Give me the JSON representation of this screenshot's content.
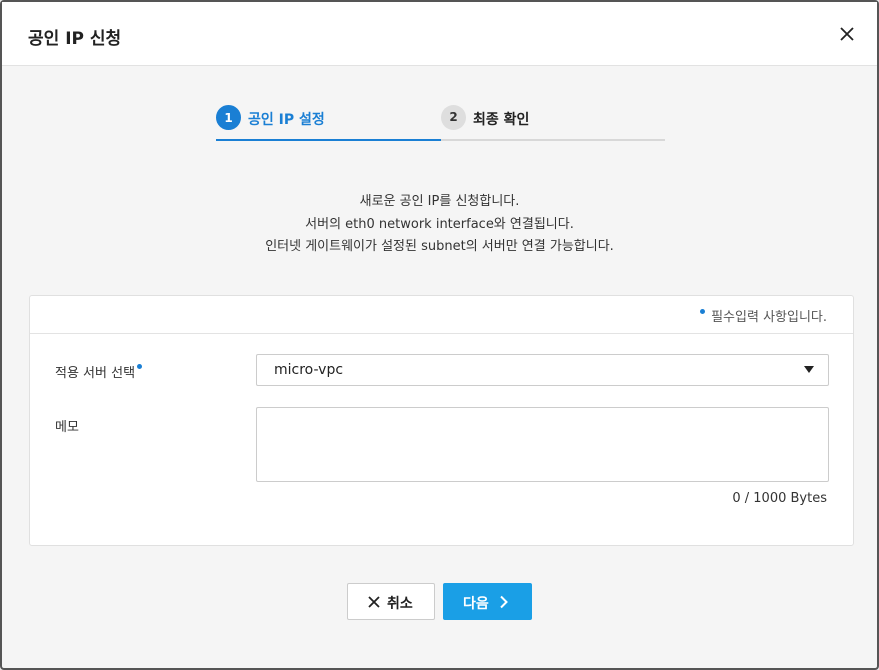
{
  "dialog": {
    "title": "공인 IP 신청",
    "close_icon": "close-icon"
  },
  "stepper": {
    "steps": [
      {
        "number": "1",
        "label": "공인 IP 설정",
        "state": "active"
      },
      {
        "number": "2",
        "label": "최종 확인",
        "state": "inactive"
      }
    ]
  },
  "description": {
    "line1": "새로운 공인 IP를 신청합니다.",
    "line2": "서버의 eth0 network interface와 연결됩니다.",
    "line3": "인터넷 게이트웨이가 설정된 subnet의 서버만 연결 가능합니다."
  },
  "form": {
    "required_note": "필수입력 사항입니다.",
    "server_label": "적용 서버 선택",
    "server_value": "micro-vpc",
    "memo_label": "메모",
    "memo_value": "",
    "memo_counter": "0 / 1000 Bytes"
  },
  "footer": {
    "cancel_label": "취소",
    "cancel_icon": "close-icon",
    "next_label": "다음",
    "next_icon": "chevron-right-icon"
  },
  "colors": {
    "accent": "#1a7fd4",
    "primary_button": "#1a9fe6"
  }
}
